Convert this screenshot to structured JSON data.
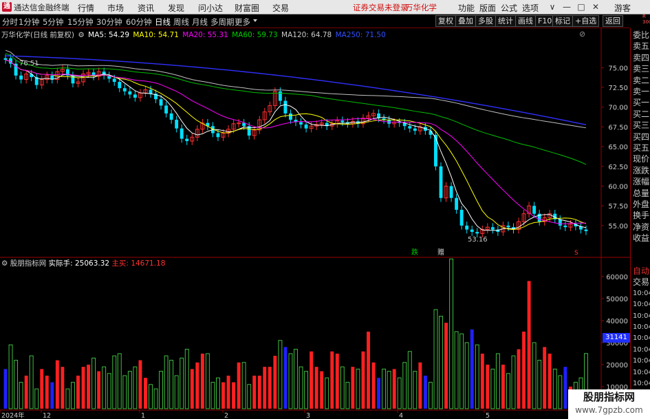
{
  "app": {
    "title": "通达信金融终端",
    "icon_text": "通",
    "guest_label": "游客"
  },
  "menu": [
    "行情",
    "市场",
    "资讯",
    "发现",
    "问小达",
    "财富圈",
    "交易"
  ],
  "status_text": "证券交易未登录",
  "stock_name_top": "万华化学",
  "toolbar_right": [
    "功能",
    "版面",
    "公式",
    "选项"
  ],
  "window_buttons": [
    "∨",
    "—",
    "□",
    "✕"
  ],
  "periods": [
    "分时",
    "1分钟",
    "5分钟",
    "15分钟",
    "30分钟",
    "60分钟",
    "日线",
    "周线",
    "月线",
    "多周期",
    "更多"
  ],
  "active_period": "日线",
  "right_buttons": [
    "复权",
    "叠加",
    "多股",
    "统计",
    "画线",
    "F10",
    "标记",
    "+自选",
    "返回"
  ],
  "ma_legend": {
    "title": "万华化学(日线 前复权)",
    "ma5": "MA5: 54.29",
    "ma10": "MA10: 54.71",
    "ma20": "MA20: 55.31",
    "ma60": "MA60: 59.73",
    "ma120": "MA120: 64.78",
    "ma250": "MA250: 71.50"
  },
  "volume_legend": {
    "title": "股朋指标网",
    "shishou": "实际手: 25063.32",
    "zhumai": "主买: 14671.18"
  },
  "right_panel_top": [
    "委比",
    "卖五",
    "卖四",
    "卖三",
    "卖二",
    "卖一",
    "买一",
    "买二",
    "买三",
    "买四",
    "买五",
    "现价",
    "涨跌",
    "涨幅",
    "总量",
    "外盘",
    "换手",
    "净资",
    "收益"
  ],
  "right_panel_bottom": [
    "自动",
    "交易",
    "10:04",
    "10:04",
    "10:04",
    "10:04",
    "10:04",
    "10:04",
    "10:04",
    "10:04",
    "10:04",
    "10:04"
  ],
  "right_corner": "R\n300",
  "markers": {
    "high_label": "76.51",
    "low_label": "53.16",
    "die": "跌",
    "zeng": "赠",
    "s_mark": "S",
    "box_value": "31141"
  },
  "x_labels": [
    "2024年",
    "12",
    "1",
    "2",
    "3",
    "4",
    "5"
  ],
  "colors": {
    "up": "#ff3030",
    "down": "#00e0ff",
    "ma5": "#ffffff",
    "ma10": "#ffff00",
    "ma20": "#ff00ff",
    "ma60": "#00c000",
    "ma120": "#c0c0c0",
    "ma250": "#3030ff",
    "vol_up": "#ff2020",
    "vol_down_outline": "#40c040",
    "vol_blue": "#2020ff"
  },
  "chart_data": {
    "type": "candlestick",
    "price_axis": {
      "ticks": [
        "75.00",
        "72.50",
        "70.00",
        "67.50",
        "65.00",
        "62.50",
        "60.00",
        "57.50",
        "55.00"
      ],
      "ylim": [
        53.16,
        76.51
      ]
    },
    "volume_axis": {
      "ticks": [
        "60000",
        "50000",
        "40000",
        "30000",
        "20000",
        "10000"
      ],
      "ylim": [
        0,
        65000
      ]
    },
    "close": [
      76.0,
      75.5,
      74.0,
      73.5,
      74.2,
      73.8,
      72.8,
      73.5,
      74.0,
      73.5,
      74.5,
      74.8,
      74.0,
      73.0,
      73.2,
      74.2,
      74.4,
      73.9,
      74.5,
      74.0,
      73.6,
      73.2,
      72.4,
      72.0,
      71.6,
      71.2,
      71.8,
      72.2,
      71.7,
      71.0,
      70.2,
      69.2,
      68.4,
      67.3,
      66.0,
      65.7,
      66.2,
      67.2,
      68.0,
      67.6,
      66.7,
      66.2,
      66.7,
      67.2,
      67.9,
      68.0,
      67.6,
      66.4,
      67.1,
      68.4,
      69.4,
      70.2,
      72.0,
      70.8,
      69.2,
      68.4,
      68.1,
      67.8,
      67.3,
      67.6,
      67.8,
      68.0,
      67.6,
      67.9,
      68.3,
      68.1,
      67.9,
      68.2,
      67.9,
      68.6,
      68.9,
      69.2,
      68.6,
      68.4,
      67.9,
      68.1,
      68.0,
      67.6,
      67.3,
      67.0,
      67.5,
      67.0,
      66.5,
      62.5,
      58.5,
      60.0,
      58.5,
      57.0,
      55.0,
      54.5,
      54.2,
      54.0,
      54.5,
      54.8,
      54.5,
      54.2,
      55.0,
      54.8,
      54.5,
      55.5,
      56.5,
      57.5,
      56.5,
      55.5,
      56.0,
      56.5,
      55.8,
      55.0,
      54.8,
      55.2,
      54.9,
      54.5,
      54.3
    ],
    "open": [
      76.2,
      76.2,
      75.5,
      74.0,
      73.5,
      74.2,
      73.8,
      72.8,
      73.5,
      74.0,
      73.5,
      74.5,
      74.8,
      74.0,
      73.0,
      73.2,
      74.2,
      74.4,
      73.9,
      74.5,
      74.0,
      73.6,
      73.2,
      72.4,
      72.0,
      71.6,
      71.2,
      71.8,
      72.2,
      71.7,
      71.0,
      70.2,
      69.2,
      68.4,
      67.3,
      66.0,
      65.7,
      66.2,
      67.2,
      68.0,
      67.6,
      66.7,
      66.2,
      66.7,
      67.2,
      67.9,
      68.0,
      67.6,
      66.4,
      67.1,
      68.4,
      69.4,
      70.2,
      72.0,
      70.8,
      69.2,
      68.4,
      68.1,
      67.8,
      67.3,
      67.6,
      67.8,
      68.0,
      67.6,
      67.9,
      68.3,
      68.1,
      67.9,
      68.2,
      67.9,
      68.6,
      68.9,
      69.2,
      68.6,
      68.4,
      67.9,
      68.1,
      68.0,
      67.6,
      67.3,
      67.0,
      67.5,
      67.0,
      66.5,
      62.5,
      58.5,
      60.0,
      58.5,
      57.0,
      55.0,
      54.5,
      54.2,
      54.0,
      54.5,
      54.8,
      54.5,
      54.2,
      55.0,
      54.8,
      54.5,
      55.5,
      56.5,
      57.5,
      56.5,
      55.5,
      56.0,
      56.5,
      55.8,
      55.0,
      54.8,
      55.2,
      54.9,
      54.5
    ],
    "volume": [
      18000,
      29000,
      22000,
      12000,
      15000,
      24000,
      9000,
      18000,
      15000,
      12000,
      22000,
      19000,
      9000,
      12000,
      15000,
      19000,
      20000,
      23000,
      17000,
      19000,
      16000,
      24000,
      25000,
      15000,
      17000,
      19000,
      22000,
      14000,
      11000,
      9000,
      17000,
      24000,
      22000,
      15000,
      23000,
      27000,
      18000,
      21000,
      25000,
      25000,
      12000,
      14000,
      12000,
      15000,
      12000,
      21000,
      21000,
      11000,
      15000,
      15000,
      19000,
      19000,
      24000,
      31000,
      28000,
      25000,
      27000,
      19000,
      17000,
      26000,
      19000,
      17000,
      14000,
      26000,
      25000,
      19000,
      12000,
      19000,
      18000,
      26000,
      35000,
      21000,
      14000,
      18000,
      17000,
      18000,
      14000,
      21000,
      26000,
      17000,
      21000,
      15000,
      12000,
      45000,
      42000,
      39000,
      68000,
      35000,
      34000,
      30000,
      36000,
      29000,
      25000,
      20000,
      18000,
      25000,
      20000,
      16000,
      24000,
      27000,
      35000,
      58000,
      30000,
      22000,
      28000,
      25000,
      18000,
      15000,
      19000,
      10000,
      12000,
      14000,
      25063
    ]
  }
}
